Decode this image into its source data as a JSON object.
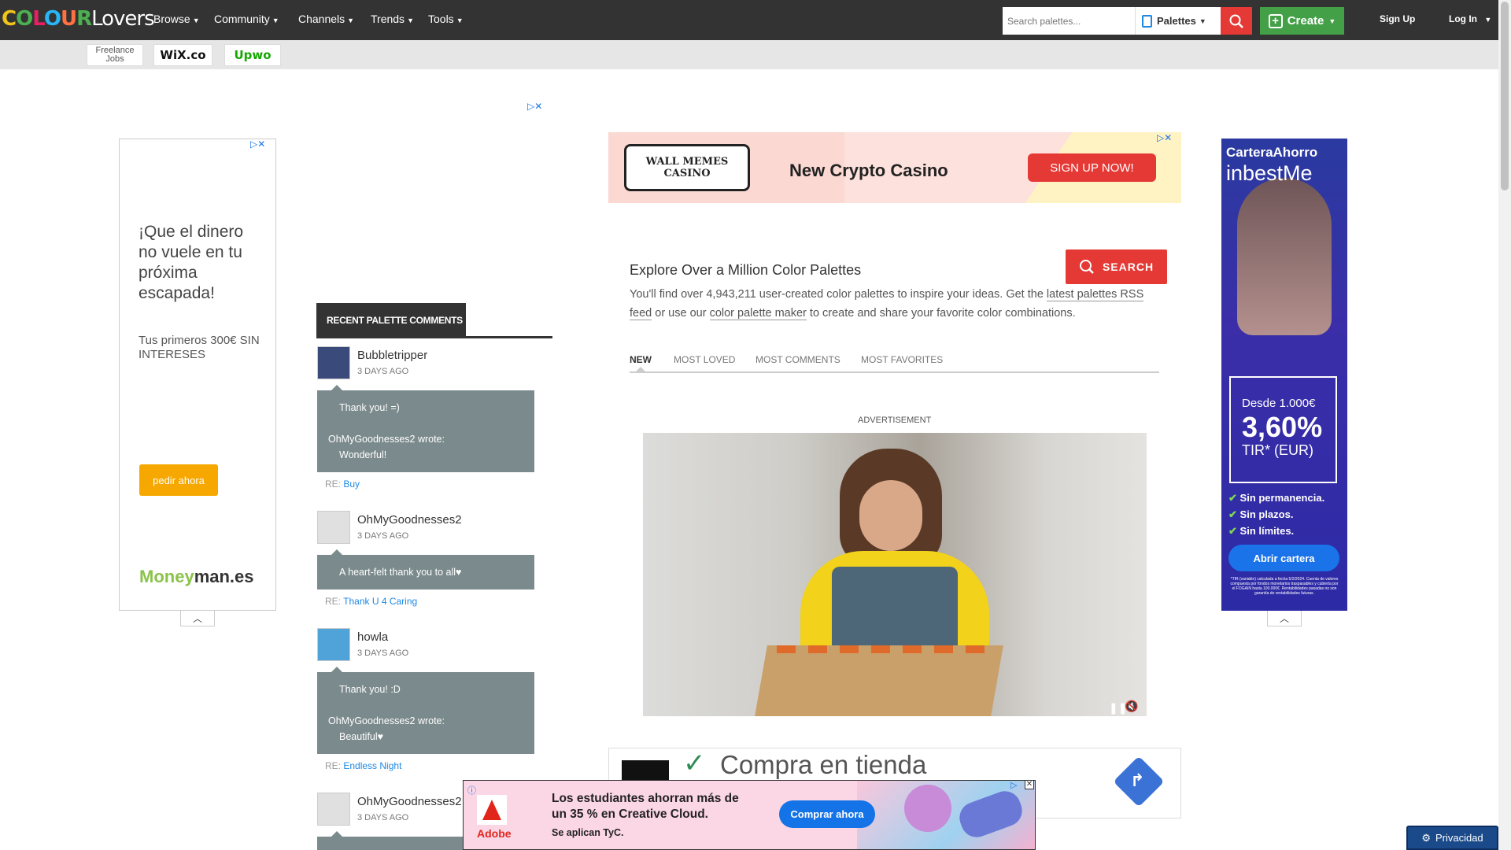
{
  "nav": {
    "logo_colour": "COLOUR",
    "logo_lovers": "Lovers",
    "items": [
      {
        "label": "Browse"
      },
      {
        "label": "Community"
      },
      {
        "label": "Channels"
      },
      {
        "label": "Trends"
      },
      {
        "label": "Tools"
      }
    ],
    "search_placeholder": "Search palettes...",
    "search_type": "Palettes",
    "create_label": "Create",
    "signup_label": "Sign Up",
    "login_label": "Log In"
  },
  "sponsors": {
    "freelance": "Freelance Jobs",
    "wix": "WiX.co",
    "upwork": "Upwo"
  },
  "left_ad": {
    "headline": "¡Que el dinero no vuele en tu próxima escapada!",
    "subline": "Tus primeros 300€ SIN INTERESES",
    "button": "pedir ahora",
    "brand_a": "Money",
    "brand_b": "man.es"
  },
  "top_banner": {
    "logo": "WALL MEMES CASINO",
    "headline": "New Crypto Casino",
    "button": "SIGN UP NOW!"
  },
  "comments": {
    "header": "RECENT PALETTE COMMENTS",
    "items": [
      {
        "user": "Bubbletripper",
        "time": "3 DAYS AGO",
        "line1": "Thank you! =)",
        "line2": "OhMyGoodnesses2 wrote:",
        "line3": "Wonderful!",
        "re_prefix": "RE:",
        "re_link": "Buy"
      },
      {
        "user": "OhMyGoodnesses2",
        "time": "3 DAYS AGO",
        "line1": "A heart-felt thank you to all♥",
        "re_prefix": "RE:",
        "re_link": "Thank U 4 Caring"
      },
      {
        "user": "howla",
        "time": "3 DAYS AGO",
        "line1": "Thank you! :D",
        "line2": "OhMyGoodnesses2 wrote:",
        "line3": "Beautiful♥",
        "re_prefix": "RE:",
        "re_link": "Endless Night"
      },
      {
        "user": "OhMyGoodnesses2",
        "time": "3 DAYS AGO"
      }
    ]
  },
  "explore": {
    "title": "Explore Over a Million Color Palettes",
    "desc_a": "You'll find over 4,943,211 user-created color palettes to inspire your ideas. Get the ",
    "desc_link1": "latest palettes RSS feed",
    "desc_b": " or use our ",
    "desc_link2": "color palette maker",
    "desc_c": " to create and share your favorite color combinations.",
    "search_button": "SEARCH",
    "tabs": [
      "NEW",
      "MOST LOVED",
      "MOST COMMENTS",
      "MOST FAVORITES"
    ],
    "advertisement_label": "ADVERTISEMENT"
  },
  "shop_ad": {
    "text": "Compra en tienda"
  },
  "bottom_ad": {
    "brand": "Adobe",
    "headline": "Los estudiantes ahorran más de un 35 % en Creative Cloud.",
    "small": "Se aplican TyC.",
    "button": "Comprar ahora"
  },
  "right_ad": {
    "brand_a": "CarteraAhorro",
    "brand_b": "inbestMe",
    "from": "Desde 1.000€",
    "rate": "3,60%",
    "tir": "TIR* (EUR)",
    "bullets": [
      "Sin permanencia.",
      "Sin plazos.",
      "Sin límites."
    ],
    "button": "Abrir cartera",
    "footnote": "*TIR (variable) calculada a fecha 5/2/2024. Cuenta de valores compuesta por fondos monetarios traspasables y cubierta por el FOGAIN hasta 100.000€. Rentabilidades pasadas no son garantía de rentabilidades futuras."
  },
  "privacy_label": "Privacidad",
  "colors": {
    "nav_bg": "#333333",
    "accent_red": "#e53935",
    "create_green": "#43a047",
    "link_blue": "#1e88e5",
    "bubble_gray": "#7b8a8c"
  }
}
